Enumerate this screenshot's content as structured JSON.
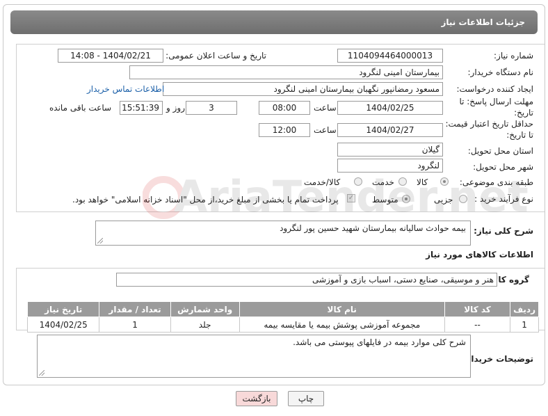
{
  "header": {
    "title": "جزئیات اطلاعات نیاز"
  },
  "fields": {
    "need_number_label": "شماره نیاز:",
    "need_number": "1104094464000013",
    "announce_label": "تاریخ و ساعت اعلان عمومی:",
    "announce_value": "1404/02/21 - 14:08",
    "buyer_label": "نام دستگاه خریدار:",
    "buyer_value": "بیمارستان امینی لنگرود",
    "creator_label": "ایجاد کننده درخواست:",
    "creator_value": "مسعود رمضانپور نگهبان بیمارستان امینی لنگرود",
    "contact_link": "اطلاعات تماس خریدار",
    "deadline_label_1": "مهلت ارسال پاسخ: تا",
    "deadline_label_2": "تاریخ:",
    "deadline_date": "1404/02/25",
    "time_label": "ساعت",
    "deadline_time": "08:00",
    "days_value": "3",
    "days_label": "روز و",
    "remaining_time": "15:51:39",
    "remaining_label": "ساعت باقی مانده",
    "validity_label_1": "حداقل تاریخ اعتبار قیمت:",
    "validity_label_2": "تا تاریخ:",
    "validity_date": "1404/02/27",
    "validity_time": "12:00",
    "province_label": "استان محل تحویل:",
    "province_value": "گیلان",
    "city_label": "شهر محل تحویل:",
    "city_value": "لنگرود",
    "category_label": "طبقه بندی موضوعی:",
    "category_options": [
      "کالا",
      "خدمت",
      "کالا/خدمت"
    ],
    "process_label": "نوع فرآیند خرید :",
    "process_options": [
      "جزیی",
      "متوسط"
    ],
    "payment_note": "پرداخت تمام یا بخشی از مبلغ خرید،از محل \"اسناد خزانه اسلامی\" خواهد بود."
  },
  "summary": {
    "label": "شرح کلی نیاز:",
    "value": "بیمه حوادث سالیانه بیمارستان شهید حسین پور لنگرود"
  },
  "goods": {
    "section_title": "اطلاعات کالاهای مورد نیاز",
    "group_label": "گروه کالا:",
    "group_value": "هنر و موسیقی، صنایع دستی، اسباب بازی و آموزشی",
    "columns": [
      "ردیف",
      "کد کالا",
      "نام کالا",
      "واحد شمارش",
      "تعداد / مقدار",
      "تاریخ نیاز"
    ],
    "rows": [
      [
        "1",
        "--",
        "مجموعه آموزشی پوشش بیمه یا مقایسه بیمه",
        "جلد",
        "1",
        "1404/02/25"
      ]
    ]
  },
  "buyer_notes": {
    "label": "توضیحات خریدار:",
    "value": "شرح کلی موارد بیمه در فایلهای پیوستی می باشد."
  },
  "buttons": {
    "print": "چاپ",
    "back": "بازگشت"
  },
  "watermark": {
    "text": "AriaTender.net"
  }
}
